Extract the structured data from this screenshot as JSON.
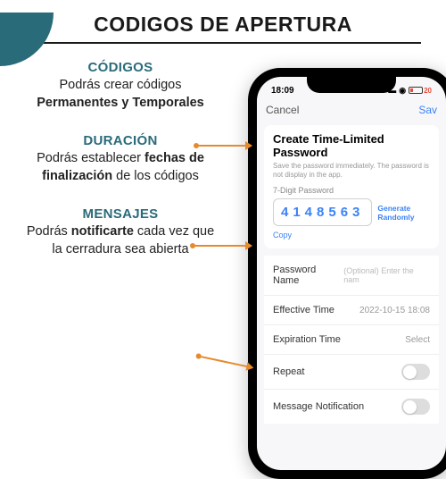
{
  "title": "CODIGOS DE APERTURA",
  "sections": [
    {
      "title": "CÓDIGOS",
      "pre": "Podrás crear códigos ",
      "bold": "Permanentes y Temporales",
      "post": ""
    },
    {
      "title": "DURACIÓN",
      "pre": "Podrás establecer ",
      "bold": "fechas de finalización",
      "post": " de los códigos"
    },
    {
      "title": "MENSAJES",
      "pre": "Podrás ",
      "bold": "notificarte",
      "post": " cada vez que la cerradura sea abierta"
    }
  ],
  "phone": {
    "time": "18:09",
    "battery": "20",
    "nav": {
      "cancel": "Cancel",
      "save": "Sav"
    },
    "card": {
      "title": "Create Time-Limited Password",
      "sub": "Save the password immediately. The password is not display in the app.",
      "pwdLabel": "7-Digit Password",
      "password": "4148563",
      "generate": "Generate Randomly",
      "copy": "Copy"
    },
    "rows": {
      "name": {
        "label": "Password Name",
        "placeholder": "(Optional) Enter the nam"
      },
      "effective": {
        "label": "Effective Time",
        "value": "2022-10-15 18:08"
      },
      "expiration": {
        "label": "Expiration Time",
        "value": "Select"
      },
      "repeat": {
        "label": "Repeat"
      },
      "notify": {
        "label": "Message Notification"
      }
    }
  }
}
